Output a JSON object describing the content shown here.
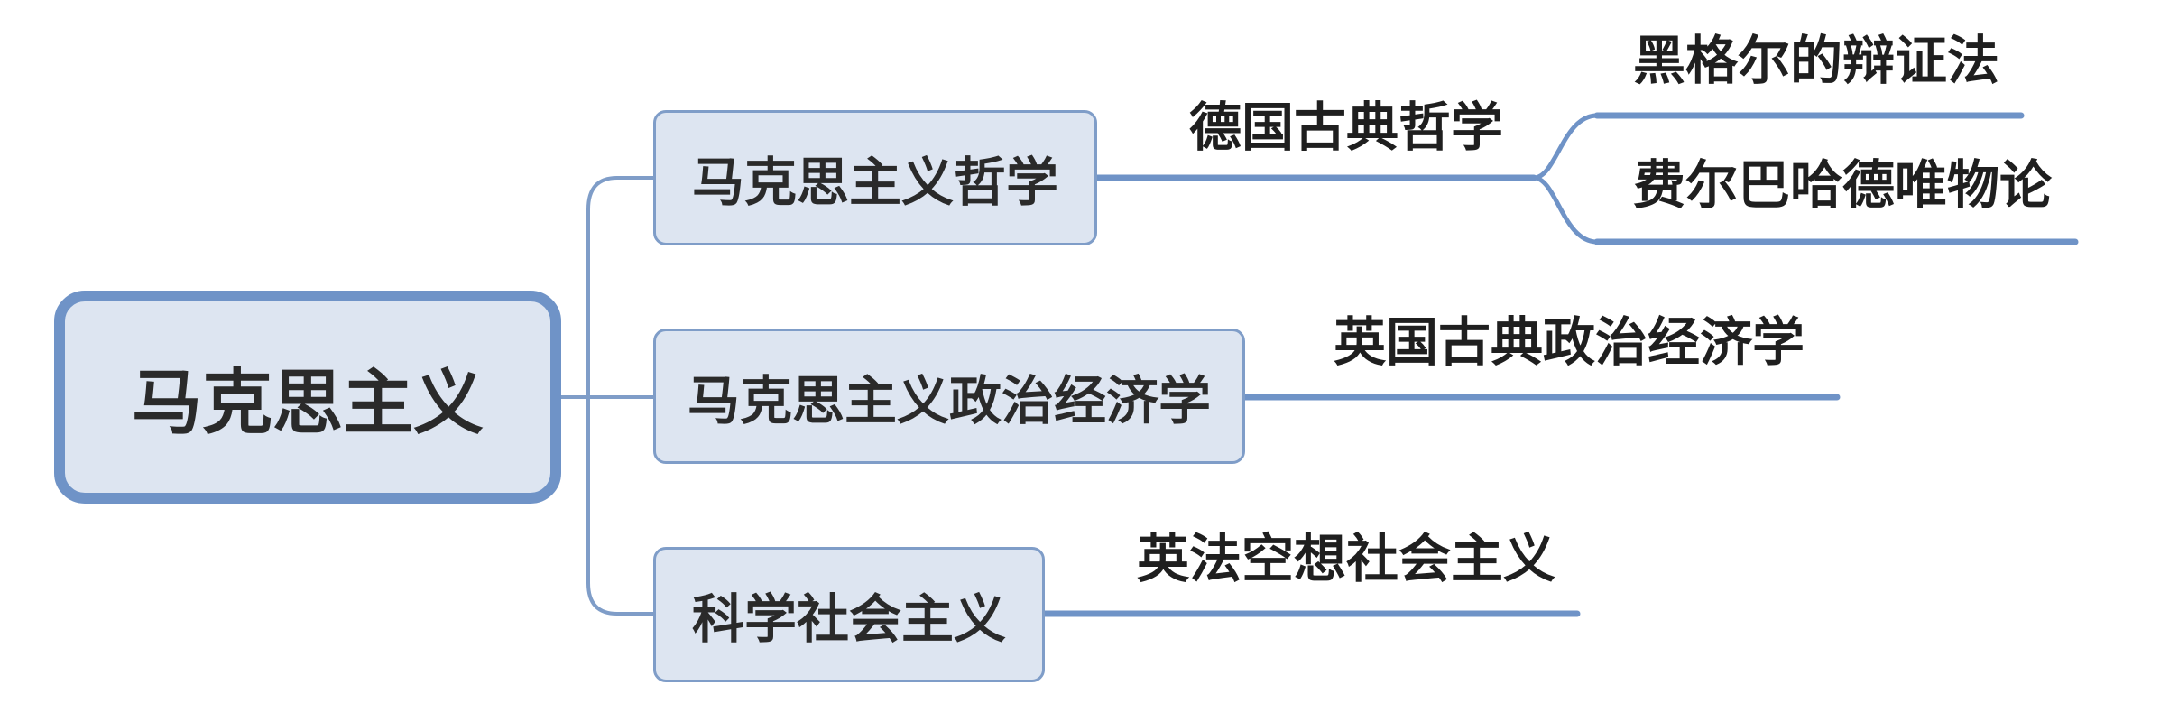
{
  "mindmap": {
    "root": "马克思主义",
    "branches": [
      {
        "label": "马克思主义哲学",
        "children": [
          {
            "label": "德国古典哲学",
            "children": [
              "黑格尔的辩证法",
              "费尔巴哈德唯物论"
            ]
          }
        ]
      },
      {
        "label": "马克思主义政治经济学",
        "children": [
          {
            "label": "英国古典政治经济学"
          }
        ]
      },
      {
        "label": "科学社会主义",
        "children": [
          {
            "label": "英法空想社会主义"
          }
        ]
      }
    ]
  },
  "colors": {
    "line": "#7f9dc8",
    "root_border": "#6f93c7",
    "box_fill": "#dde5f1",
    "text": "#2a2a2a"
  }
}
